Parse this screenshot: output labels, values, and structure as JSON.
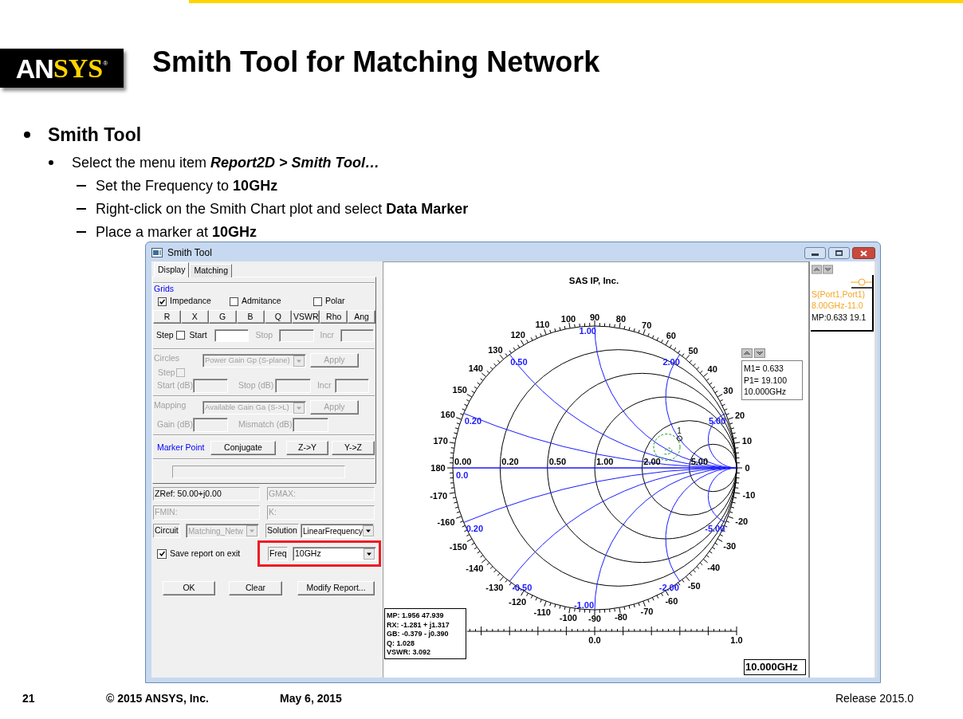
{
  "slide": {
    "logo": [
      "AN",
      "SYS",
      "®"
    ],
    "title": "Smith Tool for Matching Network",
    "bullets": [
      {
        "text": "Smith Tool",
        "children": [
          {
            "text": "Select the menu item *Report2D > Smith Tool…*",
            "children": [
              {
                "text": "Set the Frequency to **10GHz**"
              },
              {
                "text": "Right-click on the Smith Chart plot and select **Data Marker**"
              },
              {
                "text": "Place a marker at **10GHz**"
              }
            ]
          }
        ]
      }
    ],
    "footer": {
      "page": "21",
      "copyright": "© 2015 ANSYS, Inc.",
      "date": "May 6, 2015",
      "release": "Release 2015.0"
    }
  },
  "window": {
    "title": "Smith Tool",
    "tabs": [
      {
        "label": "Display",
        "selected": true
      },
      {
        "label": "Matching",
        "selected": false
      }
    ],
    "grids": {
      "label": "Grids",
      "options": [
        {
          "label": "Impedance",
          "checked": true
        },
        {
          "label": "Admitance",
          "checked": false
        },
        {
          "label": "Polar",
          "checked": false
        }
      ],
      "buttons": [
        "R",
        "X",
        "G",
        "B",
        "Q",
        "VSWR",
        "Rho",
        "Ang"
      ],
      "step": {
        "label": "Step",
        "checked": false
      },
      "fields": [
        {
          "label": "Start",
          "disabled": false
        },
        {
          "label": "Stop",
          "disabled": true
        },
        {
          "label": "Incr",
          "disabled": true
        }
      ]
    },
    "circles": {
      "label": "Circles",
      "disabled": true,
      "dropdown": "Power Gain Gp (S-plane)",
      "apply": "Apply",
      "step": {
        "label": "Step",
        "checked": false
      },
      "fields": [
        "Start (dB)",
        "Stop (dB)",
        "Incr"
      ]
    },
    "mapping": {
      "label": "Mapping",
      "disabled": true,
      "dropdown": "Available Gain Ga (S->L)",
      "apply": "Apply",
      "fields": [
        "Gain (dB)",
        "Mismatch (dB)"
      ]
    },
    "marker_point": {
      "label": "Marker Point",
      "buttons": [
        "Conjugate",
        "Z->Y",
        "Y->Z"
      ]
    },
    "results": [
      {
        "text": "ZRef: 50.00+j0.00",
        "disabled": false
      },
      {
        "text": "GMAX:",
        "disabled": true
      },
      {
        "text": "FMIN:",
        "disabled": true
      },
      {
        "text": "K:",
        "disabled": true
      }
    ],
    "circuit": {
      "label": "Circuit",
      "value": "Matching_Netw",
      "disabled": true
    },
    "solution": {
      "label": "Solution",
      "value": "LinearFrequency",
      "disabled": false
    },
    "save_report": {
      "label": "Save report on exit",
      "checked": true
    },
    "freq": {
      "label": "Freq",
      "value": "10GHz",
      "highlighted": true
    },
    "buttons": [
      "OK",
      "Clear",
      "Modify Report..."
    ],
    "chart": {
      "title": "SAS IP, Inc.",
      "angle_labels_upper": [
        "180",
        "170",
        "160",
        "150",
        "140",
        "130",
        "120",
        "110",
        "100",
        "90",
        "80",
        "70",
        "60",
        "50",
        "40",
        "30",
        "20",
        "10",
        "0"
      ],
      "angle_labels_lower": [
        "-170",
        "-160",
        "-150",
        "-140",
        "-130",
        "-120",
        "-110",
        "-100",
        "-90",
        "-80",
        "-70",
        "-60",
        "-50",
        "-40",
        "-30",
        "-20",
        "-10"
      ],
      "resistance_labels": [
        "0.00",
        "0.20",
        "0.50",
        "1.00",
        "2.00",
        "5.00"
      ],
      "origin_label": "0.0",
      "reactance_labels_upper": [
        "0.20",
        "0.50",
        "1.00",
        "2.00",
        "5.00"
      ],
      "reactance_labels_lower": [
        "0.20",
        "-0.50",
        "-1.00",
        "-2.00",
        "-5.00"
      ],
      "marker_label": "1",
      "marker_info": [
        "M1= 0.633",
        "P1= 19.100",
        "10.000GHz"
      ],
      "readout": [
        "MP: 1.956 47.939",
        "RX: -1.281 + j1.317",
        "GB: -0.379 - j0.390",
        "Q: 1.028",
        "VSWR: 3.092"
      ],
      "scale_labels": [
        "0.0",
        "1.0"
      ],
      "frequency": "10.000GHz"
    },
    "legend": {
      "trace": "S(Port1,Port1)",
      "range": "8.00GHz-11.0",
      "marker": "MP:0.633 19.1"
    }
  }
}
